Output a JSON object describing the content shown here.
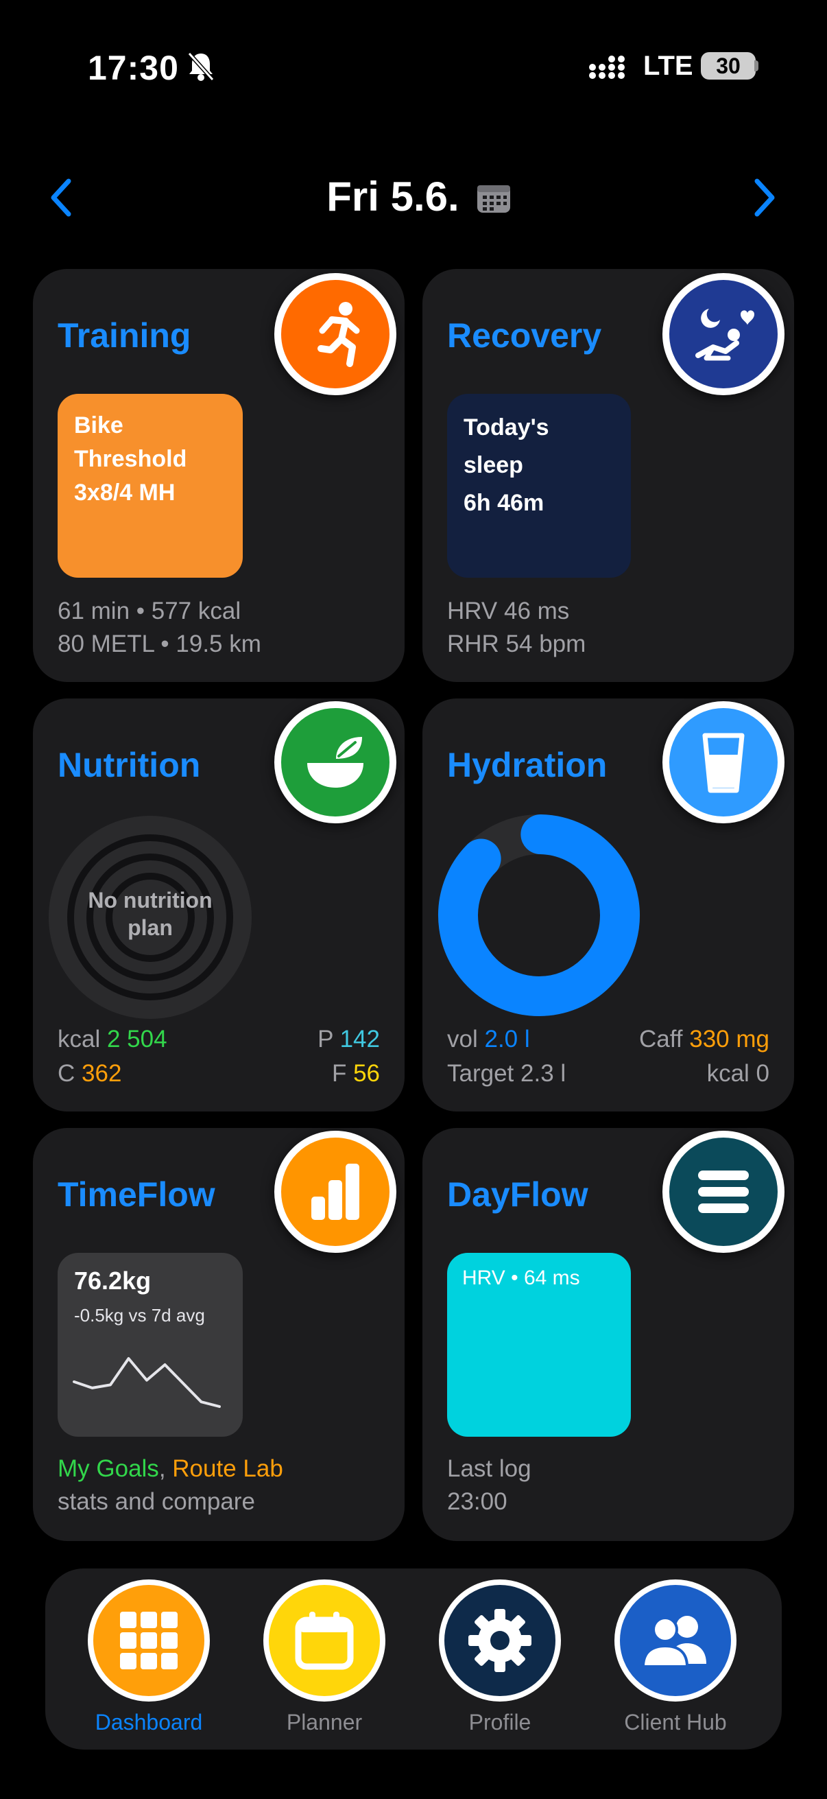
{
  "status": {
    "time": "17:30",
    "network": "LTE",
    "battery": "30"
  },
  "header": {
    "date": "Fri 5.6."
  },
  "cards": {
    "training": {
      "title": "Training",
      "workout_line1": "Bike",
      "workout_line2": "Threshold",
      "workout_line3": "3x8/4 MH",
      "meta1": "61 min • 577 kcal",
      "meta2": "80 METL • 19.5 km",
      "tile_color": "#f7902c",
      "badge_color": "#ff6a00"
    },
    "recovery": {
      "title": "Recovery",
      "sleep_line1": "Today's",
      "sleep_line2": "sleep",
      "sleep_line3": "6h 46m",
      "meta1": "HRV 46 ms",
      "meta2": "RHR 54 bpm",
      "tile_color": "#13203f",
      "badge_color": "#1f3a93"
    },
    "nutrition": {
      "title": "Nutrition",
      "ring_text": "No nutrition plan",
      "kcal_label": "kcal",
      "kcal_value": "2 504",
      "p_label": "P",
      "p_value": "142",
      "c_label": "C",
      "c_value": "362",
      "f_label": "F",
      "f_value": "56",
      "badge_color": "#1e9e3a"
    },
    "hydration": {
      "title": "Hydration",
      "vol_label": "vol",
      "vol_value": "2.0 l",
      "caff_label": "Caff",
      "caff_value": "330 mg",
      "target": "Target 2.3 l",
      "kcal": "kcal 0",
      "progress": 0.87,
      "ring_color": "#0a84ff",
      "badge_color": "#2f9bff"
    },
    "timeflow": {
      "title": "TimeFlow",
      "weight": "76.2kg",
      "delta": "-0.5kg vs 7d avg",
      "link1": "My Goals",
      "separator": ",",
      "link2": "Route Lab",
      "meta": "stats and compare",
      "sparkline": [
        42,
        34,
        38,
        72,
        44,
        64,
        40,
        16,
        10
      ],
      "badge_color": "#ff9500"
    },
    "dayflow": {
      "title": "DayFlow",
      "tile_text": "HRV • 64 ms",
      "meta1": "Last log",
      "meta2": "23:00",
      "tile_color": "#00d2de",
      "badge_color": "#0b4a5a"
    }
  },
  "tabs": [
    {
      "label": "Dashboard",
      "icon": "grid-icon",
      "active": true,
      "color": "#ff9f0a"
    },
    {
      "label": "Planner",
      "icon": "calendar-icon",
      "active": false,
      "color": "#ffd60a"
    },
    {
      "label": "Profile",
      "icon": "gear-icon",
      "active": false,
      "color": "#0e2a4a"
    },
    {
      "label": "Client Hub",
      "icon": "people-icon",
      "active": false,
      "color": "#1b5fc7"
    }
  ]
}
